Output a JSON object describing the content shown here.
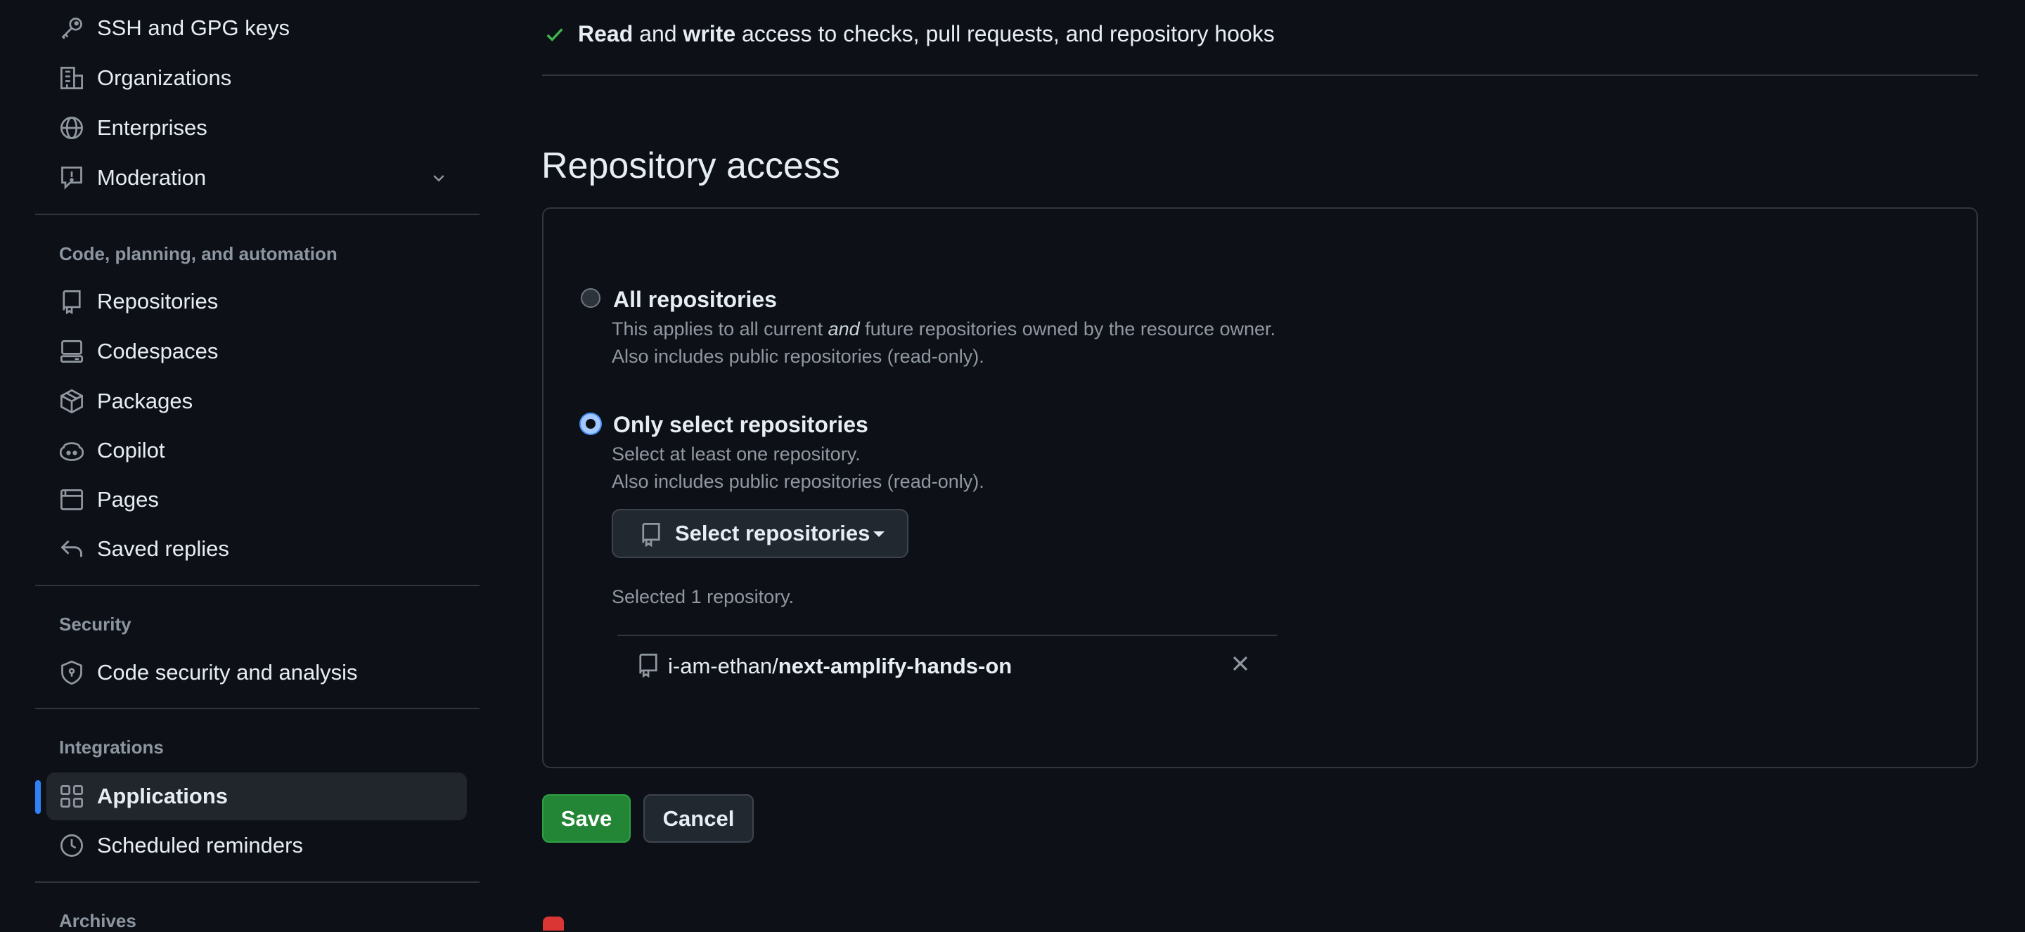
{
  "sidebar": {
    "items_top": [
      {
        "label": "SSH and GPG keys",
        "icon": "key-icon"
      },
      {
        "label": "Organizations",
        "icon": "organization-icon"
      },
      {
        "label": "Enterprises",
        "icon": "globe-icon"
      },
      {
        "label": "Moderation",
        "icon": "report-icon",
        "expandable": true
      }
    ],
    "sections": [
      {
        "heading": "Code, planning, and automation",
        "items": [
          {
            "label": "Repositories",
            "icon": "repo-icon"
          },
          {
            "label": "Codespaces",
            "icon": "codespaces-icon"
          },
          {
            "label": "Packages",
            "icon": "package-icon"
          },
          {
            "label": "Copilot",
            "icon": "copilot-icon"
          },
          {
            "label": "Pages",
            "icon": "browser-icon"
          },
          {
            "label": "Saved replies",
            "icon": "reply-icon"
          }
        ]
      },
      {
        "heading": "Security",
        "items": [
          {
            "label": "Code security and analysis",
            "icon": "shield-lock-icon"
          }
        ]
      },
      {
        "heading": "Integrations",
        "items": [
          {
            "label": "Applications",
            "icon": "apps-icon",
            "active": true
          },
          {
            "label": "Scheduled reminders",
            "icon": "clock-icon"
          }
        ]
      },
      {
        "heading": "Archives",
        "items": []
      }
    ]
  },
  "permission": {
    "read": "Read",
    "and": " and ",
    "write": "write",
    "rest": " access to checks, pull requests, and repository hooks"
  },
  "repository_access": {
    "title": "Repository access",
    "options": [
      {
        "label": "All repositories",
        "desc_line1_pre": "This applies to all current ",
        "desc_line1_em": "and",
        "desc_line1_post": " future repositories owned by the resource owner.",
        "desc_line2": "Also includes public repositories (read-only).",
        "selected": false
      },
      {
        "label": "Only select repositories",
        "desc_line1": "Select at least one repository.",
        "desc_line2": "Also includes public repositories (read-only).",
        "selected": true
      }
    ],
    "select_button": "Select repositories",
    "selected_count": "Selected 1 repository.",
    "repos": [
      {
        "owner": "i-am-ethan/",
        "name": "next-amplify-hands-on"
      }
    ]
  },
  "actions": {
    "save": "Save",
    "cancel": "Cancel"
  },
  "colors": {
    "background": "#0d1117",
    "accent": "#2f81f7",
    "save_green": "#238636",
    "check_green": "#3fb950"
  }
}
